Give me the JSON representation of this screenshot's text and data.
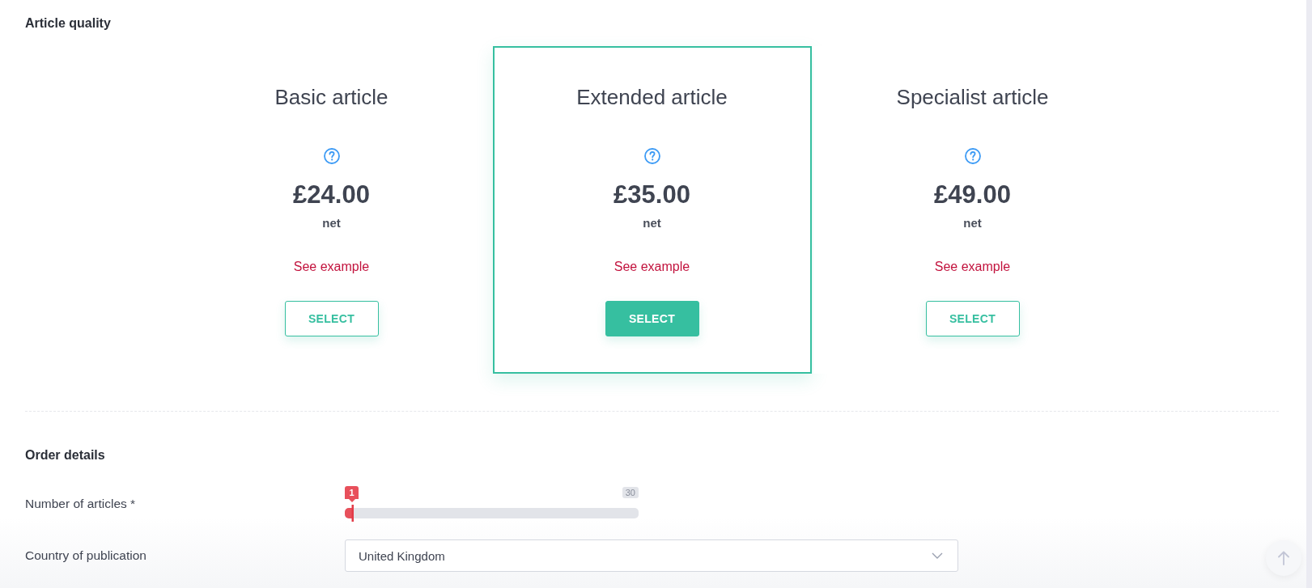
{
  "article_quality": {
    "heading": "Article quality",
    "options": [
      {
        "title": "Basic article",
        "price": "£24.00",
        "price_note": "net",
        "example_link": "See example",
        "button": "SELECT",
        "selected": false
      },
      {
        "title": "Extended article",
        "price": "£35.00",
        "price_note": "net",
        "example_link": "See example",
        "button": "SELECT",
        "selected": true
      },
      {
        "title": "Specialist article",
        "price": "£49.00",
        "price_note": "net",
        "example_link": "See example",
        "button": "SELECT",
        "selected": false
      }
    ]
  },
  "order_details": {
    "heading": "Order details",
    "fields": [
      {
        "kind": "slider",
        "label": "Number of articles *",
        "value_label": "1",
        "max_label": "30",
        "level": 0
      },
      {
        "kind": "dropdown",
        "label": "Country of publication",
        "value": "United Kingdom"
      }
    ]
  }
}
